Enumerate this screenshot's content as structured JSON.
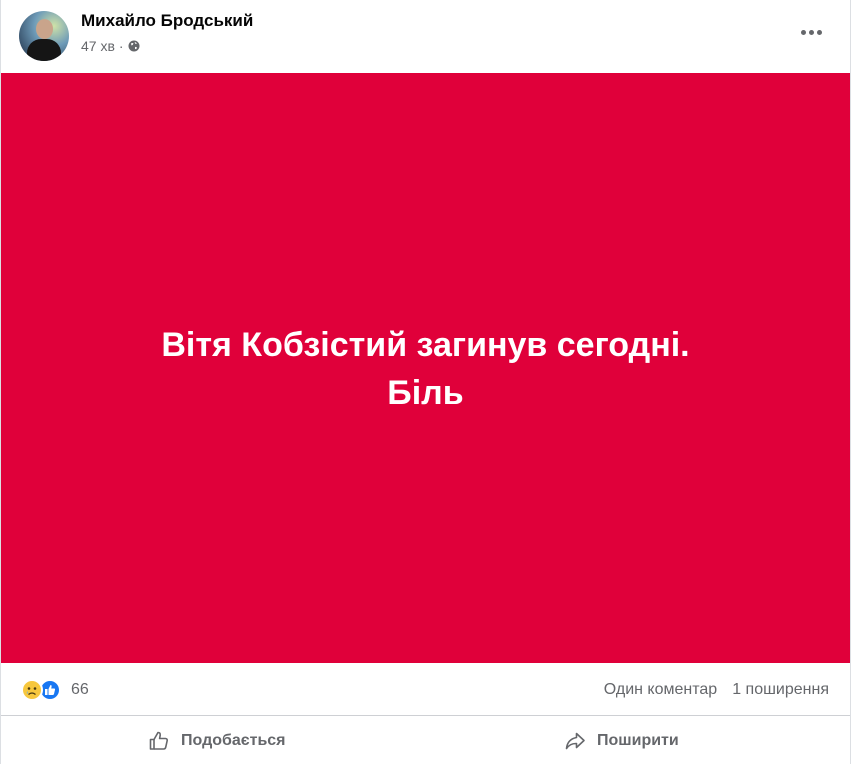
{
  "post": {
    "author": "Михайло Бродський",
    "time": "47 хв",
    "separator": "·",
    "privacy_icon": "globe-icon",
    "more_icon": "more-options-icon",
    "banner": {
      "line1": "Вітя Кобзістий загинув сегодні.",
      "line2": "Біль",
      "background_color": "#e0003a",
      "text_color": "#ffffff"
    },
    "reactions": {
      "icons": [
        "sad-reaction-icon",
        "like-reaction-icon"
      ],
      "count": "66"
    },
    "comments": "Один коментар",
    "shares": "1 поширення",
    "actions": {
      "like_label": "Подобається",
      "share_label": "Поширити"
    }
  }
}
